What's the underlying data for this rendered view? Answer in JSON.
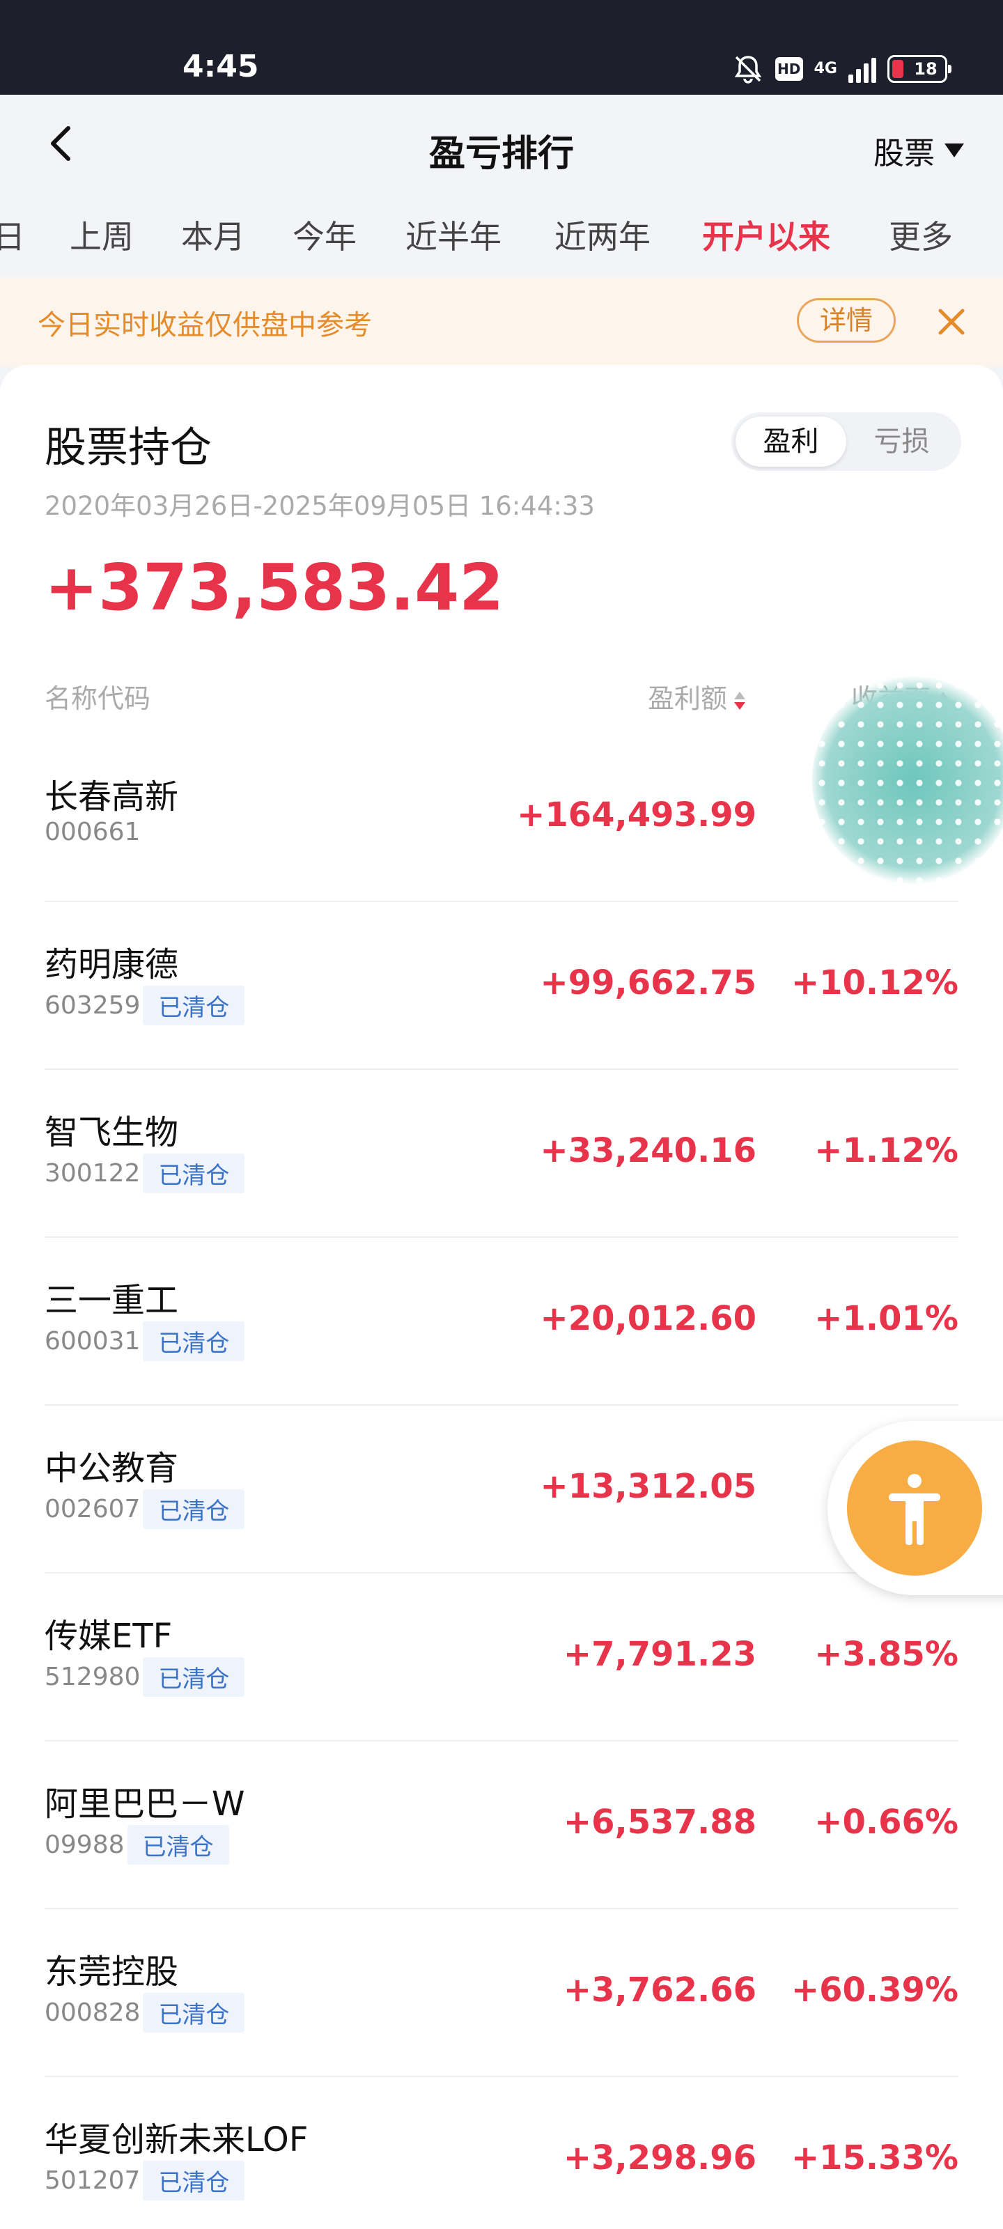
{
  "status_bar": {
    "time": "4:45",
    "network": "4G",
    "hd": "HD",
    "battery": "18",
    "icons": [
      "bell-muted-icon",
      "hd-icon",
      "signal-icon",
      "battery-icon"
    ]
  },
  "header": {
    "title": "盈亏排行",
    "market_selector": "股票",
    "back_icon": "chevron-left-icon"
  },
  "tabs": [
    {
      "label": "日",
      "active": false
    },
    {
      "label": "上周",
      "active": false
    },
    {
      "label": "本月",
      "active": false
    },
    {
      "label": "今年",
      "active": false
    },
    {
      "label": "近半年",
      "active": false
    },
    {
      "label": "近两年",
      "active": false
    },
    {
      "label": "开户以来",
      "active": true
    },
    {
      "label": "更多",
      "active": false
    }
  ],
  "notice": {
    "text": "今日实时收益仅供盘中参考",
    "detail_label": "详情"
  },
  "holdings": {
    "title": "股票持仓",
    "toggle": {
      "profit": "盈利",
      "loss": "亏损",
      "selected": "盈利"
    },
    "date_range": "2020年03月26日-2025年09月05日 16:44:33",
    "total": "+373,583.42",
    "columns": {
      "name": "名称代码",
      "amount": "盈利额",
      "rate": "收益率"
    },
    "rows": [
      {
        "name": "长春高新",
        "code": "000661",
        "tag": "",
        "amount": "+164,493.99",
        "rate": ""
      },
      {
        "name": "药明康德",
        "code": "603259",
        "tag": "已清仓",
        "amount": "+99,662.75",
        "rate": "+10.12%"
      },
      {
        "name": "智飞生物",
        "code": "300122",
        "tag": "已清仓",
        "amount": "+33,240.16",
        "rate": "+1.12%"
      },
      {
        "name": "三一重工",
        "code": "600031",
        "tag": "已清仓",
        "amount": "+20,012.60",
        "rate": "+1.01%"
      },
      {
        "name": "中公教育",
        "code": "002607",
        "tag": "已清仓",
        "amount": "+13,312.05",
        "rate": "+"
      },
      {
        "name": "传媒ETF",
        "code": "512980",
        "tag": "已清仓",
        "amount": "+7,791.23",
        "rate": "+3.85%"
      },
      {
        "name": "阿里巴巴－W",
        "code": "09988",
        "tag": "已清仓",
        "amount": "+6,537.88",
        "rate": "+0.66%"
      },
      {
        "name": "东莞控股",
        "code": "000828",
        "tag": "已清仓",
        "amount": "+3,762.66",
        "rate": "+60.39%"
      },
      {
        "name": "华夏创新未来LOF",
        "code": "501207",
        "tag": "已清仓",
        "amount": "+3,298.96",
        "rate": "+15.33%"
      }
    ]
  },
  "colors": {
    "accent_red": "#e8344a",
    "notice_orange": "#e58b2a",
    "tag_blue": "#3b73c9",
    "accessibility_orange": "#f8ad44"
  }
}
